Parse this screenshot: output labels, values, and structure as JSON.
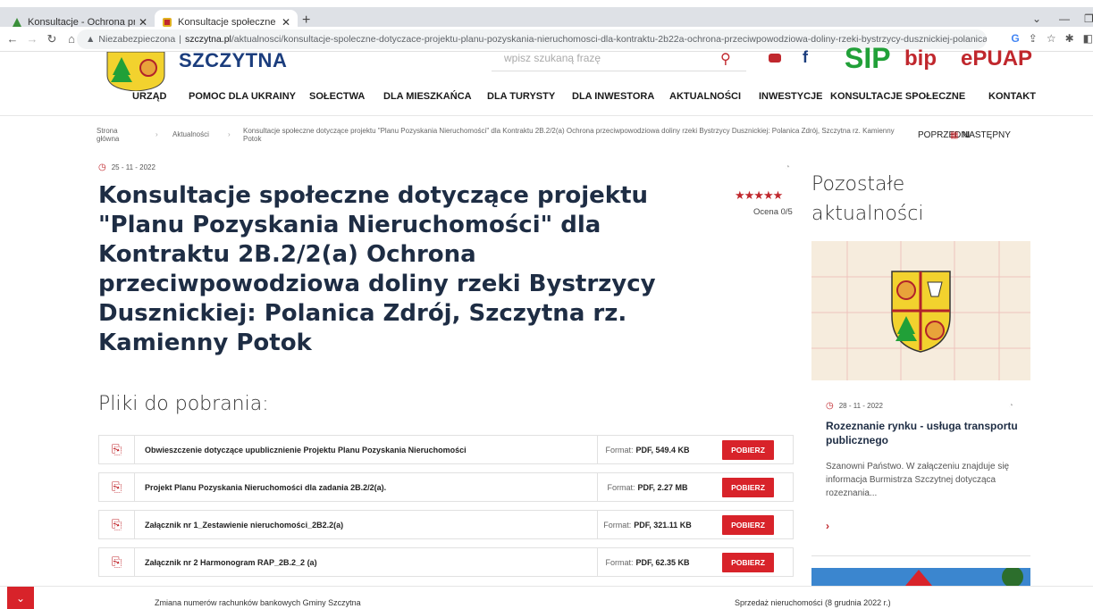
{
  "browser": {
    "tabs": [
      {
        "title": "Konsultacje - Ochrona przeciwpo..."
      },
      {
        "title": "Konsultacje społeczne dotyczące..."
      }
    ],
    "new_tab": "+",
    "address": {
      "security": "Niezabezpieczona",
      "domain": "szczytna.pl",
      "path": "/aktualnosci/konsultacje-spoleczne-dotyczace-projektu-planu-pozyskania-nieruchomosci-dla-kontraktu-2b22a-ochrona-przeciwpowodziowa-doliny-rzeki-bystrzycy-dusznickiej-polanica-zdroj-szczytna-rz-kamie..."
    }
  },
  "site": {
    "name": "SZCZYTNA",
    "search_placeholder": "wpisz szukaną frazę",
    "logos": {
      "sip": "SIP",
      "bip": "bip",
      "epuap": "ePUAP"
    },
    "nav": [
      "URZĄD",
      "POMOC DLA UKRAINY",
      "SOŁECTWA",
      "DLA MIESZKAŃCA",
      "DLA TURYSTY",
      "DLA INWESTORA",
      "AKTUALNOŚCI",
      "INWESTYCJE",
      "KONSULTACJE SPOŁECZNE",
      "KONTAKT"
    ]
  },
  "breadcrumb": {
    "home": "Strona główna",
    "section": "Aktualności",
    "current": "Konsultacje społeczne dotyczące projektu \"Planu Pozyskania Nieruchomości\" dla Kontraktu 2B.2/2(a) Ochrona przeciwpowodziowa doliny rzeki Bystrzycy Dusznickiej: Polanica Zdrój, Szczytna rz. Kamienny Potok",
    "prev": "POPRZEDNI",
    "next": "NASTĘPNY"
  },
  "article": {
    "date": "25 - 11 - 2022",
    "title": "Konsultacje społeczne dotyczące projektu \"Planu Pozyskania Nieruchomości\" dla Kontraktu 2B.2/2(a) Ochrona przeciwpowodziowa doliny rzeki Bystrzycy Dusznickiej: Polanica Zdrój, Szczytna rz. Kamienny Potok",
    "stars": "★★★★★",
    "rating": "Ocena 0/5"
  },
  "files": {
    "heading": "Pliki do pobrania:",
    "format_label": "Format:",
    "button_label": "POBIERZ",
    "items": [
      {
        "name": "Obwieszczenie dotyczące upublicznienie Projektu Planu Pozyskania Nieruchomości",
        "format": "PDF, 549.4 KB"
      },
      {
        "name": "Projekt Planu Pozyskania Nieruchomości dla zadania 2B.2/2(a).",
        "format": "PDF, 2.27 MB"
      },
      {
        "name": "Załącznik nr 1_Zestawienie nieruchomości_2B2.2(a)",
        "format": "PDF, 321.11 KB"
      },
      {
        "name": "Załącznik nr 2 Harmonogram RAP_2B.2_2 (a)",
        "format": "PDF, 62.35 KB"
      }
    ]
  },
  "sidebar": {
    "title": "Pozostałe aktualności",
    "news": {
      "date": "28 - 11 - 2022",
      "headline": "Rozeznanie rynku - usługa transportu publicznego",
      "excerpt": "Szanowni Państwo. W załączeniu znajduje się informacja Burmistrza Szczytnej dotycząca rozeznania..."
    }
  },
  "ticker": {
    "item1": "Zmiana numerów rachunków bankowych Gminy Szczytna",
    "item2": "Sprzedaż nieruchomości (8 grudnia 2022 r.)"
  },
  "colors": {
    "accent": "#d8232a",
    "navy": "#1e2d44",
    "green": "#21a038"
  }
}
